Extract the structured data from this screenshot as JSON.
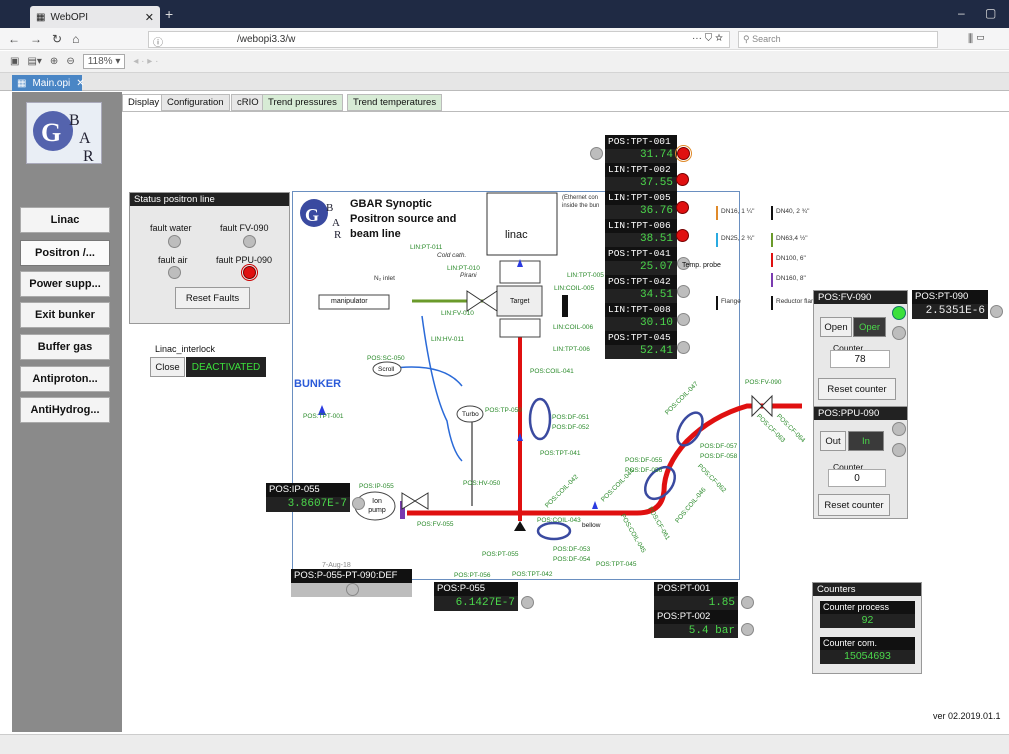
{
  "browser": {
    "tab_title": "WebOPI",
    "url": "/webopi3.3/w",
    "search_placeholder": "Search",
    "zoom": "118%",
    "editor_tab": "Main.opi"
  },
  "nav": {
    "items": [
      "Linac",
      "Positron /...",
      "Power supp...",
      "Exit bunker",
      "Buffer gas",
      "Antiproton...",
      "AntiHydrog..."
    ]
  },
  "tabs": [
    "Display",
    "Configuration",
    "cRIO",
    "Trend pressures",
    "Trend temperatures"
  ],
  "status_panel": {
    "title": "Status positron line",
    "faults": [
      "fault water",
      "fault FV-090",
      "fault air",
      "fault PPU-090"
    ],
    "reset": "Reset Faults"
  },
  "interlock": {
    "label": "Linac_interlock",
    "close": "Close",
    "state": "DEACTIVATED"
  },
  "synoptic": {
    "title_l1": "GBAR Synoptic",
    "title_l2": "Positron source and",
    "title_l3": "beam line",
    "linac": "linac",
    "bunker": "BUNKER",
    "ethernet": "(Ethernet con inside the bun",
    "manipulator": "manipulator",
    "target": "Target",
    "ion_pump": "Ion pump",
    "turbo": "Turbo",
    "scroll": "Scroll",
    "bellow": "bellow",
    "date": "7-Aug-18"
  },
  "pvs": [
    {
      "name": "POS:TPT-001",
      "value": "31.74"
    },
    {
      "name": "LIN:TPT-002",
      "value": "37.55"
    },
    {
      "name": "LIN:TPT-005",
      "value": "36.76"
    },
    {
      "name": "LIN:TPT-006",
      "value": "38.51"
    },
    {
      "name": "POS:TPT-041",
      "value": "25.07"
    },
    {
      "name": "POS:TPT-042",
      "value": "34.51"
    },
    {
      "name": "LIN:TPT-008",
      "value": "30.10"
    },
    {
      "name": "POS:TPT-045",
      "value": "52.41"
    }
  ],
  "legend": [
    {
      "label": "DN16, 1 ¼\"",
      "color": "#e08a2a"
    },
    {
      "label": "DN40, 2 ¾\"",
      "color": "#111111"
    },
    {
      "label": "DN25, 2 ¾\"",
      "color": "#2aaae0"
    },
    {
      "label": "DN63,4 ½\"",
      "color": "#6a9a2a"
    },
    {
      "label": "DN100, 6\"",
      "color": "#e01010"
    },
    {
      "label": "DN160, 8\"",
      "color": "#7a3ab0"
    },
    {
      "label": "Flange",
      "color": "#111111"
    },
    {
      "label": "Reductor flange",
      "color": "#111111"
    }
  ],
  "temp_probe": "Temp. probe",
  "fv090": {
    "title": "POS:FV-090",
    "open": "Open",
    "oper": "Oper",
    "counter_label": "Counter",
    "counter": "78",
    "reset": "Reset counter"
  },
  "ppu090": {
    "title": "POS:PPU-090",
    "out": "Out",
    "in": "In",
    "counter_label": "Counter",
    "counter": "0",
    "reset": "Reset counter"
  },
  "pt090": {
    "name": "POS:PT-090",
    "value": "2.5351E-6"
  },
  "ip055": {
    "name": "POS:IP-055",
    "value": "3.8607E-7"
  },
  "p055": {
    "name": "POS:P-055",
    "value": "6.1427E-7"
  },
  "pt001": {
    "name": "POS:PT-001",
    "value": "1.85"
  },
  "pt002": {
    "name": "POS:PT-002",
    "value": "5.4 bar"
  },
  "p055def": {
    "name": "POS:P-055-PT-090:DEF"
  },
  "counters": {
    "title": "Counters",
    "process_label": "Counter process",
    "process": "92",
    "com_label": "Counter com.",
    "com": "15054693"
  },
  "labels": {
    "tpt001": "POS:TPT-001",
    "linpt011": "LIN:PT-011",
    "coldcath": "Cold cath.",
    "pirani": "Pirani",
    "linpt010": "LIN:PT-010",
    "n2inlet": "N₂ inlet",
    "linfv010": "LIN:FV-010",
    "linhv011": "LIN:HV-011",
    "lincoil005": "LIN:COIL-005",
    "lincoil006": "LIN:COIL-006",
    "lintpt005": "LIN:TPT-005",
    "lintpt006": "LIN:TPT-006",
    "poscoil041": "POS:COIL-041",
    "possc050": "POS:SC-050",
    "postp050": "POS:TP-050",
    "posdf051": "POS:DF-051",
    "posdf052": "POS:DF-052",
    "postpt041": "POS:TPT-041",
    "posdf055": "POS:DF-055",
    "posdf056": "POS:DF-056",
    "poscoil047": "POS:COIL-047",
    "posdf057": "POS:DF-057",
    "posdf058": "POS:DF-058",
    "poscf062": "POS:CF-062",
    "posfv090": "POS:FV-090",
    "poscf063": "POS:CF-063",
    "poscf064": "POS:CF-064",
    "poshv050": "POS:HV-050",
    "posip055": "POS:IP-055",
    "posfv055": "POS:FV-055",
    "poscoil042": "POS:COIL-042",
    "poscoil043": "POS:COIL-043",
    "poscoil044": "POS:COIL-044",
    "poscoil045": "POS:COIL-045",
    "poscoil046": "POS:COIL-046",
    "posdf053": "POS:DF-053",
    "posdf054": "POS:DF-054",
    "postpt045": "POS:TPT-045",
    "postpt042": "POS:TPT-042",
    "pospt055": "POS:PT-055",
    "pospt056": "POS:PT-056",
    "poscf061": "POS:CF-061"
  },
  "version": "ver 02.2019.01.1"
}
